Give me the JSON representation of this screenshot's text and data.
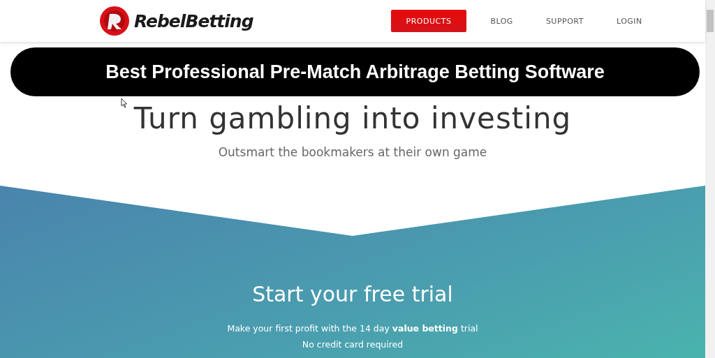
{
  "header": {
    "logo": "RebelBetting",
    "nav": [
      {
        "label": "PRODUCTS",
        "selected": true
      },
      {
        "label": "BLOG",
        "selected": false
      },
      {
        "label": "SUPPORT",
        "selected": false
      },
      {
        "label": "LOGIN",
        "selected": false
      }
    ]
  },
  "banner": "Best Professional Pre-Match Arbitrage Betting Software",
  "hero": {
    "title": "Turn gambling into investing",
    "subtitle": "Outsmart the bookmakers at their own game"
  },
  "trial": {
    "title": "Start your free trial",
    "text": "Make your first profit with the 14 day **value betting** trial",
    "note": "No credit card required"
  }
}
